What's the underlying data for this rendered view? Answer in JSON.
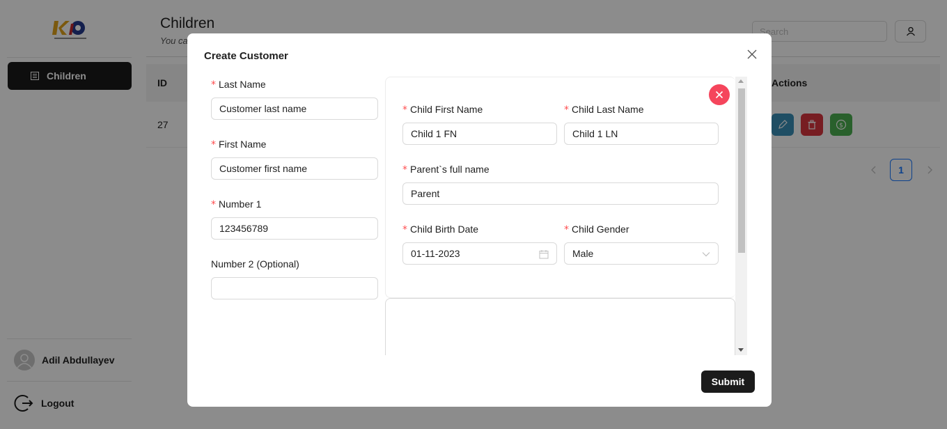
{
  "sidebar": {
    "nav_item_label": "Children",
    "user_name": "Adil Abdullayev",
    "logout_label": "Logout"
  },
  "main": {
    "title": "Children",
    "subtitle": "You ca",
    "search_placeholder": "Search",
    "table": {
      "headers": {
        "id": "ID",
        "actions": "Actions"
      },
      "rows": [
        {
          "id": "27"
        }
      ]
    },
    "pagination": {
      "current_page": "1"
    },
    "colors": {
      "edit": "#3a8fb7",
      "delete": "#d9363e",
      "pay": "#4caf50"
    }
  },
  "modal": {
    "title": "Create Customer",
    "submit_label": "Submit",
    "left": {
      "last_name_label": "Last Name",
      "last_name_value": "Customer last name",
      "first_name_label": "First Name",
      "first_name_value": "Customer first name",
      "number1_label": "Number 1",
      "number1_value": "123456789",
      "number2_label": "Number 2 (Optional)",
      "number2_value": ""
    },
    "child": {
      "first_name_label": "Child First Name",
      "first_name_value": "Child 1 FN",
      "last_name_label": "Child Last Name",
      "last_name_value": "Child 1 LN",
      "parent_label": "Parent`s full name",
      "parent_value": "Parent",
      "birth_date_label": "Child Birth Date",
      "birth_date_value": "01-11-2023",
      "gender_label": "Child Gender",
      "gender_value": "Male"
    }
  }
}
